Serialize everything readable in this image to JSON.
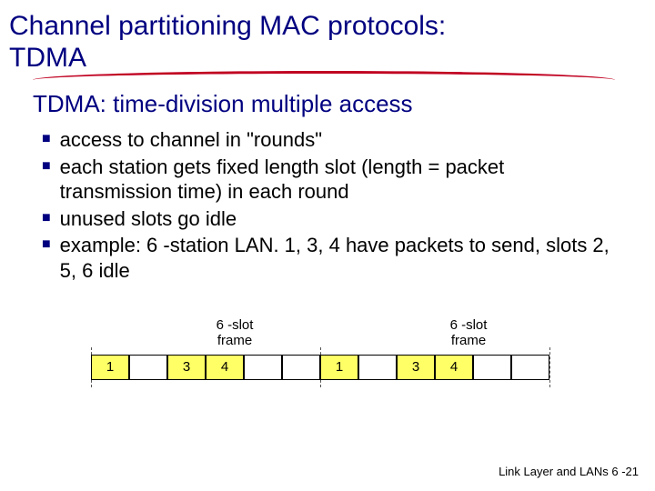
{
  "title_line1": "Channel partitioning MAC protocols:",
  "title_line2": "TDMA",
  "subtitle": "TDMA: time-division multiple access",
  "bullets": [
    "access to channel in \"rounds\"",
    "each station gets fixed length slot (length = packet transmission time) in each round",
    "unused slots go idle",
    "example: 6 -station LAN. 1, 3, 4 have packets to send, slots 2, 5, 6 idle"
  ],
  "frame_label": "6 -slot frame",
  "slots_frame1": [
    "1",
    "",
    "3",
    "4",
    "",
    ""
  ],
  "slots_frame2": [
    "1",
    "",
    "3",
    "4",
    "",
    ""
  ],
  "footer": "Link Layer and LANs  6 -21",
  "chart_data": {
    "type": "table",
    "description": "TDMA 6-slot frames. Filled slot number = transmitting station; empty = idle.",
    "frames": [
      {
        "label": "6 -slot frame",
        "slots": [
          1,
          null,
          3,
          4,
          null,
          null
        ]
      },
      {
        "label": "6 -slot frame",
        "slots": [
          1,
          null,
          3,
          4,
          null,
          null
        ]
      }
    ]
  }
}
